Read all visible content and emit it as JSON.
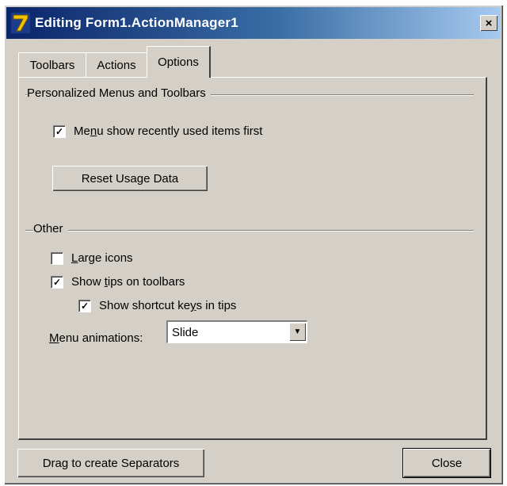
{
  "window": {
    "title": "Editing Form1.ActionManager1",
    "close_glyph": "×",
    "icon": "delphi-7-icon"
  },
  "tabs": [
    {
      "label": "Toolbars",
      "active": false
    },
    {
      "label": "Actions",
      "active": false
    },
    {
      "label": "Options",
      "active": true
    }
  ],
  "personalized": {
    "heading": "Personalized Menus and Toolbars",
    "recent_first": {
      "pre": "Me",
      "underlined": "n",
      "post": "u show recently used items first",
      "checked": true
    },
    "reset_button": "Reset Usage Data"
  },
  "other": {
    "heading": "Other",
    "large_icons": {
      "pre": "",
      "underlined": "L",
      "post": "arge icons",
      "checked": false
    },
    "show_tips": {
      "pre": "Show ",
      "underlined": "t",
      "post": "ips on toolbars",
      "checked": true
    },
    "show_shortcut": {
      "pre": "Show shortcut ke",
      "underlined": "y",
      "post": "s in tips",
      "checked": true
    },
    "menu_animations": {
      "pre": "",
      "underlined": "M",
      "post": "enu animations:",
      "value": "Slide"
    }
  },
  "footer": {
    "drag_button": "Drag to create Separators",
    "close_button": "Close"
  },
  "check_glyph": "✓",
  "dropdown_glyph": "▼"
}
